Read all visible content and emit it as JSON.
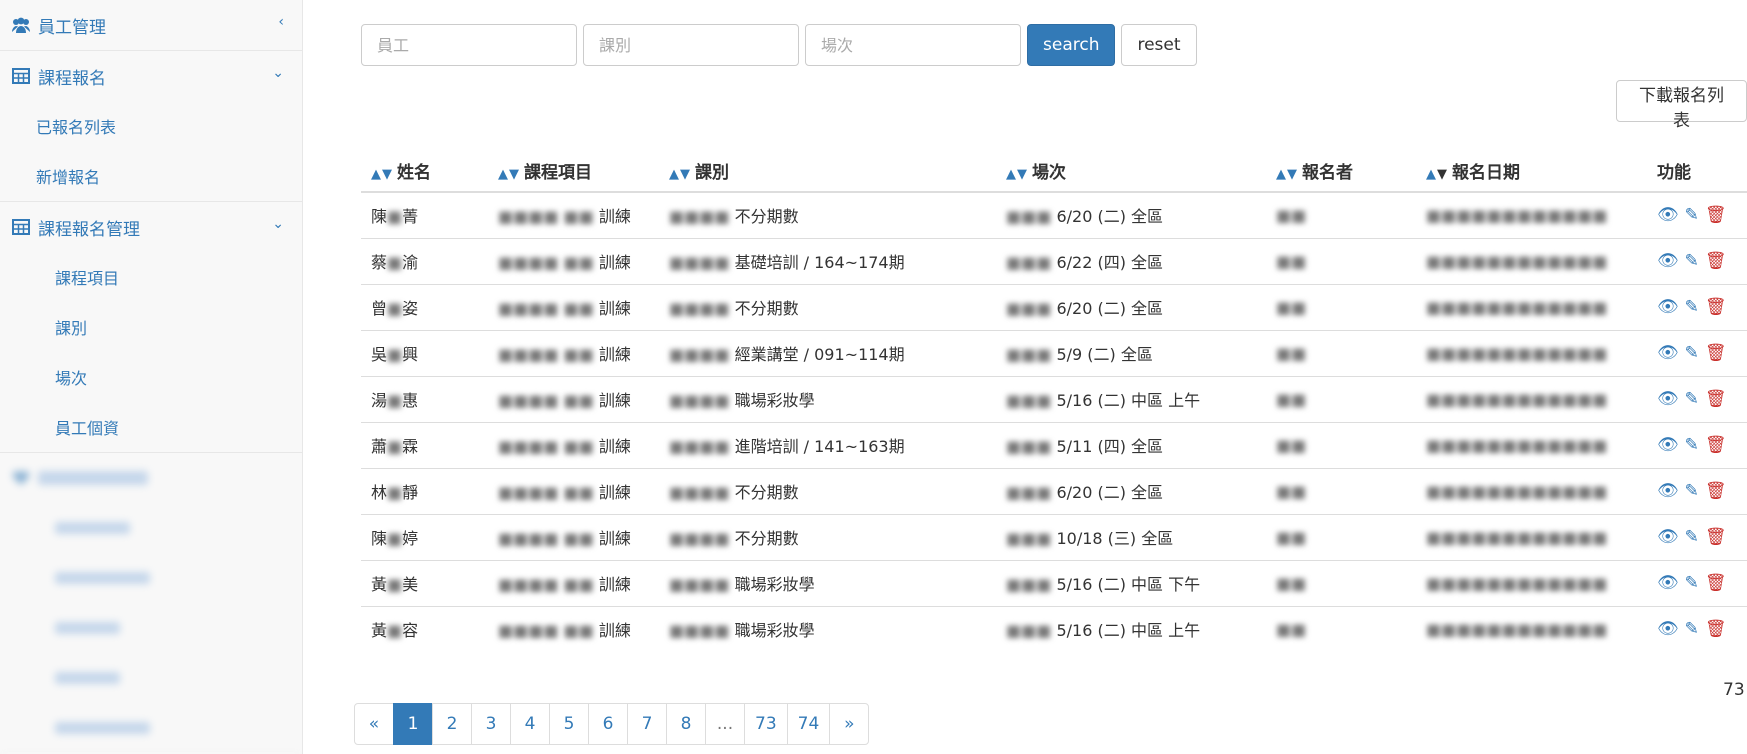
{
  "sidebar": {
    "groups": [
      {
        "label": "員工管理",
        "icon": "users-icon",
        "chevron": "‹"
      },
      {
        "label": "課程報名",
        "icon": "table-icon",
        "chevron": "⌄",
        "items": [
          "已報名列表",
          "新增報名"
        ]
      },
      {
        "label": "課程報名管理",
        "icon": "table-icon",
        "chevron": "⌄",
        "items": [
          "課程項目",
          "課別",
          "場次",
          "員工個資"
        ]
      }
    ]
  },
  "search": {
    "employee_placeholder": "員工",
    "class_placeholder": "課別",
    "session_placeholder": "場次",
    "search_label": "search",
    "reset_label": "reset"
  },
  "download_label": "下載報名列表",
  "table": {
    "headers": {
      "name": "姓名",
      "course": "課程項目",
      "class": "課別",
      "session": "場次",
      "registrant": "報名者",
      "date": "報名日期",
      "actions": "功能"
    },
    "rows": [
      {
        "name_a": "陳",
        "name_b": "菁",
        "course": "訓練",
        "class": "不分期數",
        "session": "6/20 (二) 全區"
      },
      {
        "name_a": "蔡",
        "name_b": "渝",
        "course": "訓練",
        "class": "基礎培訓 / 164~174期",
        "session": "6/22 (四) 全區"
      },
      {
        "name_a": "曾",
        "name_b": "姿",
        "course": "訓練",
        "class": "不分期數",
        "session": "6/20 (二) 全區"
      },
      {
        "name_a": "吳",
        "name_b": "興",
        "course": "訓練",
        "class": "經業講堂 / 091~114期",
        "session": "5/9 (二) 全區"
      },
      {
        "name_a": "湯",
        "name_b": "惠",
        "course": "訓練",
        "class": "職場彩妝學",
        "session": "5/16 (二) 中區 上午"
      },
      {
        "name_a": "蕭",
        "name_b": "霖",
        "course": "訓練",
        "class": "進階培訓 / 141~163期",
        "session": "5/11 (四) 全區"
      },
      {
        "name_a": "林",
        "name_b": "靜",
        "course": "訓練",
        "class": "不分期數",
        "session": "6/20 (二) 全區"
      },
      {
        "name_a": "陳",
        "name_b": "婷",
        "course": "訓練",
        "class": "不分期數",
        "session": "10/18 (三) 全區"
      },
      {
        "name_a": "黃",
        "name_b": "美",
        "course": "訓練",
        "class": "職場彩妝學",
        "session": "5/16 (二) 中區 下午"
      },
      {
        "name_a": "黃",
        "name_b": "容",
        "course": "訓練",
        "class": "職場彩妝學",
        "session": "5/16 (二) 中區 上午"
      }
    ]
  },
  "total_text": "73",
  "pagination": [
    "«",
    "1",
    "2",
    "3",
    "4",
    "5",
    "6",
    "7",
    "8",
    "...",
    "73",
    "74",
    "»"
  ],
  "colors": {
    "primary": "#337ab7",
    "danger": "#c9302c"
  }
}
